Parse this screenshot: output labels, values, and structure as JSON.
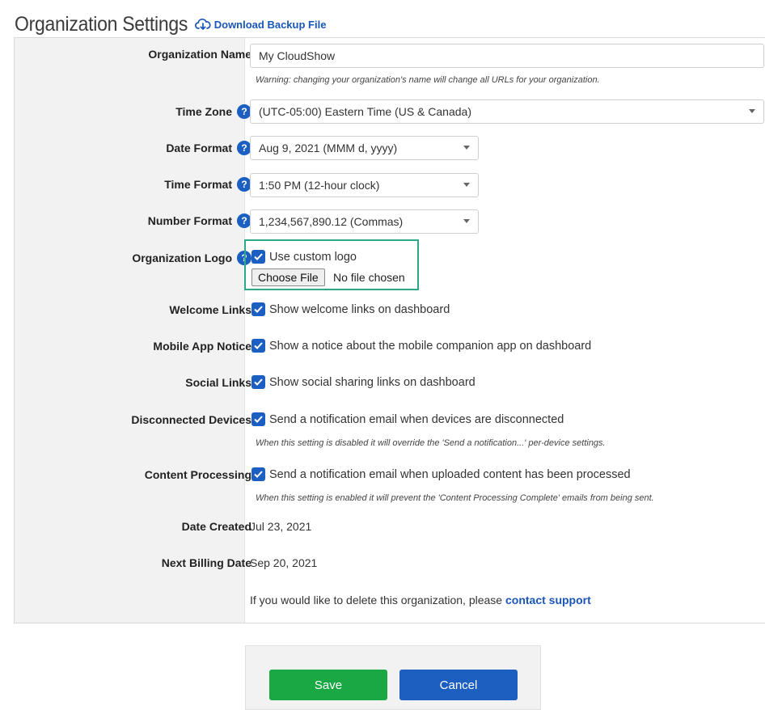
{
  "header": {
    "title": "Organization Settings",
    "download_label": "Download Backup File",
    "download_icon": "cloud-download-icon"
  },
  "colors": {
    "accent_blue": "#1b5fc2",
    "link_blue": "#1a56b8",
    "save_green": "#19a844",
    "highlight_teal": "#2fa88a"
  },
  "form": {
    "org_name": {
      "label": "Organization Name",
      "value": "My CloudShow",
      "hint": "Warning: changing your organization's name will change all URLs for your organization."
    },
    "time_zone": {
      "label": "Time Zone",
      "value": "(UTC-05:00) Eastern Time (US & Canada)",
      "help": "?"
    },
    "date_format": {
      "label": "Date Format",
      "value": "Aug 9, 2021 (MMM d, yyyy)",
      "help": "?"
    },
    "time_format": {
      "label": "Time Format",
      "value": "1:50 PM (12-hour clock)",
      "help": "?"
    },
    "number_format": {
      "label": "Number Format",
      "value": "1,234,567,890.12 (Commas)",
      "help": "?"
    },
    "org_logo": {
      "label": "Organization Logo",
      "help": "?",
      "checkbox_label": "Use custom logo",
      "checked": true,
      "choose_file_label": "Choose File",
      "no_file_text": "No file chosen"
    },
    "welcome_links": {
      "label": "Welcome Links",
      "checkbox_label": "Show welcome links on dashboard",
      "checked": true
    },
    "mobile_app_notice": {
      "label": "Mobile App Notice",
      "checkbox_label": "Show a notice about the mobile companion app on dashboard",
      "checked": true
    },
    "social_links": {
      "label": "Social Links",
      "checkbox_label": "Show social sharing links on dashboard",
      "checked": true
    },
    "disconnected_devices": {
      "label": "Disconnected Devices",
      "checkbox_label": "Send a notification email when devices are disconnected",
      "checked": true,
      "hint": "When this setting is disabled it will override the 'Send a notification...' per-device settings."
    },
    "content_processing": {
      "label": "Content Processing",
      "checkbox_label": "Send a notification email when uploaded content has been processed",
      "checked": true,
      "hint": "When this setting is enabled it will prevent the 'Content Processing Complete' emails from being sent."
    },
    "date_created": {
      "label": "Date Created",
      "value": "Jul 23, 2021"
    },
    "next_billing": {
      "label": "Next Billing Date",
      "value": "Sep 20, 2021"
    },
    "delete_notice": {
      "text": "If you would like to delete this organization, please ",
      "link_label": "contact support"
    }
  },
  "actions": {
    "save_label": "Save",
    "cancel_label": "Cancel"
  }
}
